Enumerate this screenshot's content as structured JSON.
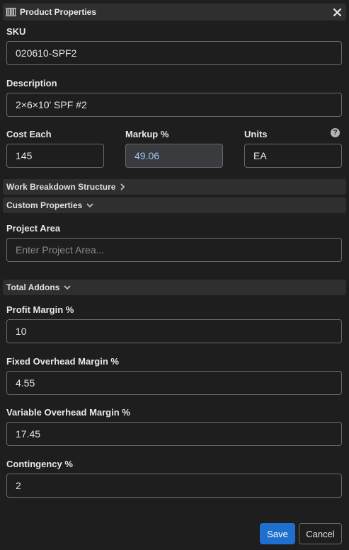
{
  "dialog": {
    "title": "Product Properties",
    "title_icon": "barcode-icon",
    "close_icon": "close-icon"
  },
  "fields": {
    "sku": {
      "label": "SKU",
      "value": "020610-SPF2"
    },
    "description": {
      "label": "Description",
      "value": "2×6×10' SPF #2"
    },
    "cost_each": {
      "label": "Cost Each",
      "value": "145"
    },
    "markup": {
      "label": "Markup %",
      "value": "49.06"
    },
    "units": {
      "label": "Units",
      "value": "EA",
      "help_icon": "question-circle-icon"
    }
  },
  "sections": {
    "wbs": {
      "label": "Work Breakdown Structure",
      "state": "collapsed",
      "icon": "chevron-right-icon"
    },
    "custom_properties": {
      "label": "Custom Properties",
      "state": "expanded",
      "icon": "chevron-down-icon"
    },
    "total_addons": {
      "label": "Total Addons",
      "state": "expanded",
      "icon": "chevron-down-icon"
    }
  },
  "custom": {
    "project_area": {
      "label": "Project Area",
      "value": "",
      "placeholder": "Enter Project Area..."
    }
  },
  "addons": {
    "profit_margin": {
      "label": "Profit Margin %",
      "value": "10"
    },
    "fixed_overhead": {
      "label": "Fixed Overhead Margin %",
      "value": "4.55"
    },
    "variable_overhead": {
      "label": "Variable Overhead Margin %",
      "value": "17.45"
    },
    "contingency": {
      "label": "Contingency %",
      "value": "2"
    }
  },
  "actions": {
    "save_label": "Save",
    "cancel_label": "Cancel"
  },
  "colors": {
    "background": "#1e1e1e",
    "header": "#2f2f2f",
    "accent": "#1f6fce",
    "readonly_text": "#9ec1f0"
  }
}
